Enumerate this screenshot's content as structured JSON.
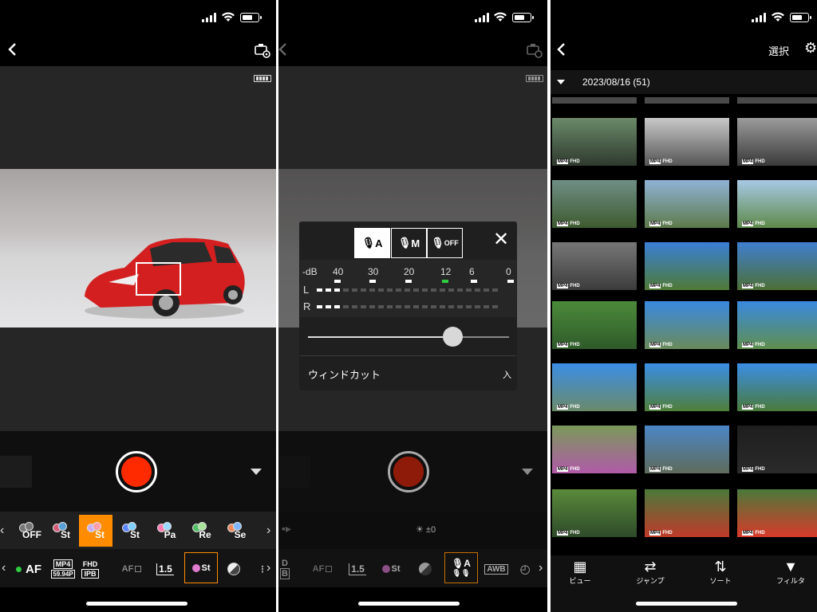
{
  "screen1": {
    "mode_icons": [
      "custom-camera-settings-icon"
    ],
    "film_styles": [
      {
        "label": "OFF",
        "selected": false,
        "colors": [
          "#777777",
          "#777777"
        ]
      },
      {
        "label": "St",
        "selected": false,
        "colors": [
          "#d65c7a",
          "#5aa0d8"
        ]
      },
      {
        "label": "St",
        "selected": true,
        "colors": [
          "#c9b0ff",
          "#ff9ea8"
        ]
      },
      {
        "label": "St",
        "selected": false,
        "colors": [
          "#5b88ff",
          "#7fd0ff"
        ]
      },
      {
        "label": "Pa",
        "selected": false,
        "colors": [
          "#ff7ab0",
          "#9ad9ff"
        ]
      },
      {
        "label": "Re",
        "selected": false,
        "colors": [
          "#52c064",
          "#a8e39a"
        ]
      },
      {
        "label": "Se",
        "selected": false,
        "colors": [
          "#f08a5d",
          "#7fb6ff"
        ]
      }
    ],
    "toolbar": {
      "af": "AF",
      "format_top": "MP4",
      "format_bottom": "59.94P",
      "quality_top": "FHD",
      "quality_bottom": "IPB",
      "af_mode": "AF",
      "zoom": "1.5",
      "film_style": "St"
    }
  },
  "screen2": {
    "mic_modes": [
      "A",
      "M",
      "OFF"
    ],
    "db_label": "-dB",
    "db_ticks": [
      "40",
      "30",
      "20",
      "12",
      "6",
      "0"
    ],
    "channel_left": "L",
    "channel_right": "R",
    "level_fraction": 0.72,
    "wind_cut_label": "ウィンドカット",
    "wind_cut_value": "入",
    "exposure": "±0",
    "toolbar": {
      "d_top": "D",
      "d_bottom": "B",
      "af_mode": "AF",
      "zoom": "1.5",
      "film_style": "St",
      "mic": "A",
      "awb": "AWB"
    }
  },
  "screen3": {
    "select_label": "選択",
    "date_header": "2023/08/16 (51)",
    "badge_format": "MP4",
    "badge_quality": "FHD",
    "nav": [
      {
        "label": "ビュー",
        "icon": "grid-icon"
      },
      {
        "label": "ジャンプ",
        "icon": "jump-icon"
      },
      {
        "label": "ソート",
        "icon": "sort-icon"
      },
      {
        "label": "フィルタ",
        "icon": "filter-icon"
      }
    ]
  }
}
